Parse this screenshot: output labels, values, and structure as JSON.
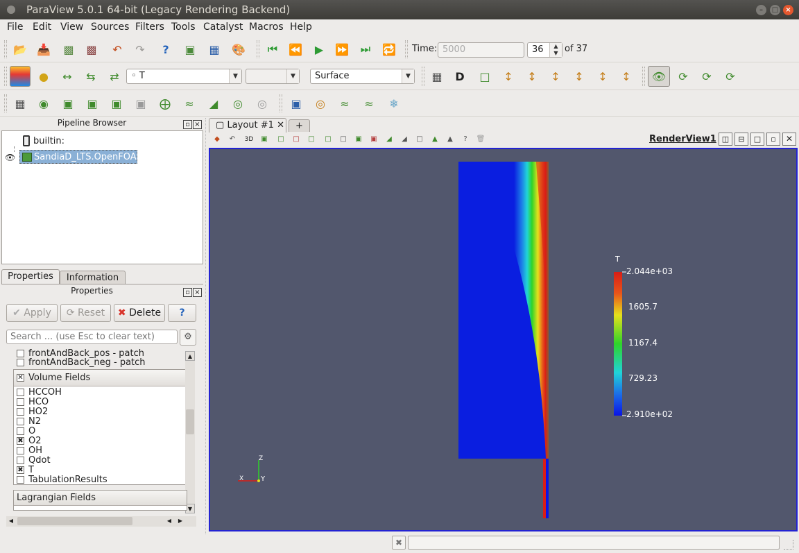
{
  "window": {
    "title": "ParaView 5.0.1 64-bit (Legacy Rendering Backend)"
  },
  "menu": [
    "File",
    "Edit",
    "View",
    "Sources",
    "Filters",
    "Tools",
    "Catalyst",
    "Macros",
    "Help"
  ],
  "time": {
    "label": "Time:",
    "value": "5000",
    "step": "36",
    "of": "of 37"
  },
  "toolbar": {
    "array_select": "T",
    "component_select": "",
    "representation": "Surface",
    "array_prefix": "◦"
  },
  "pipeline": {
    "title": "Pipeline Browser",
    "root": "builtin:",
    "item": "SandiaD_LTS.OpenFOAM"
  },
  "panel_tabs": [
    "Properties",
    "Information"
  ],
  "properties": {
    "title": "Properties",
    "apply": "Apply",
    "reset": "Reset",
    "delete": "Delete",
    "help": "?",
    "search_placeholder": "Search ... (use Esc to clear text)",
    "patches": [
      "frontAndBack_pos - patch",
      "frontAndBack_neg - patch"
    ],
    "volume_fields_title": "Volume Fields",
    "volume_fields": [
      {
        "name": "HCCOH",
        "checked": false
      },
      {
        "name": "HCO",
        "checked": false
      },
      {
        "name": "HO2",
        "checked": false
      },
      {
        "name": "N2",
        "checked": false
      },
      {
        "name": "O",
        "checked": false
      },
      {
        "name": "O2",
        "checked": true
      },
      {
        "name": "OH",
        "checked": false
      },
      {
        "name": "Qdot",
        "checked": false
      },
      {
        "name": "T",
        "checked": true
      },
      {
        "name": "TabulationResults",
        "checked": false
      }
    ],
    "lagrangian_title": "Lagrangian Fields"
  },
  "layout": {
    "tab": "Layout #1",
    "add": "+",
    "view_name": "RenderView1",
    "mode_3d": "3D"
  },
  "colorbar": {
    "title": "T",
    "labels": [
      "2.044e+03",
      "1605.7",
      "1167.4",
      "729.23",
      "2.910e+02"
    ]
  },
  "axes": {
    "x": "X",
    "y": "Y",
    "z": "Z"
  },
  "colors": {
    "background": "#52576d",
    "view_border": "#2323d2",
    "accent": "#e4572e"
  }
}
